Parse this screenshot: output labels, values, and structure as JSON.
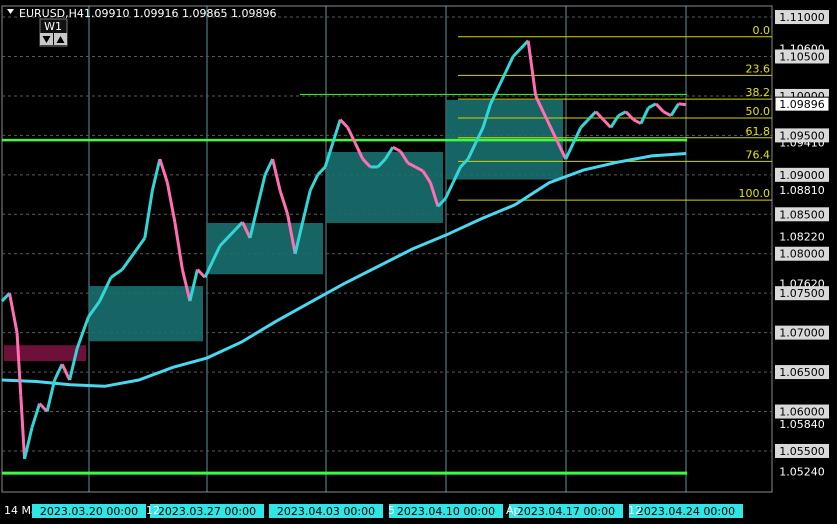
{
  "header": {
    "symbol": "EURUSD,H4",
    "ohlc": "1.09910 1.09916 1.09865 1.09896",
    "badge": "W1"
  },
  "chart_data": {
    "type": "candlestick",
    "symbol": "EURUSD",
    "timeframe": "H4",
    "ylim": [
      1.0498,
      1.1114
    ],
    "x_time_labels": [
      "14 Ma",
      "2023.03.20 00:00",
      "2023.03.27 00:00",
      "2023.04.03 00:00",
      "2023.04.10 00:00",
      "2023.04.17 00:00",
      "2023.04.24 00:00"
    ],
    "x_partial_labels": [
      "12",
      "5",
      "Ap",
      "12"
    ],
    "y_ticks": [
      1.11,
      1.106,
      1.105,
      1.1,
      1.09896,
      1.0941,
      1.095,
      1.09,
      1.0881,
      1.085,
      1.0822,
      1.08,
      1.0762,
      1.075,
      1.07,
      1.065,
      1.06,
      1.0584,
      1.055,
      1.0524
    ],
    "y_boxed_levels": [
      1.11,
      1.105,
      1.1,
      1.095,
      1.09,
      1.085,
      1.08,
      1.075,
      1.07,
      1.065,
      1.06,
      1.055
    ],
    "current_price": 1.09896,
    "fibonacci": {
      "levels": [
        {
          "label": "0.0",
          "price": 1.1075
        },
        {
          "label": "23.6",
          "price": 1.1026
        },
        {
          "label": "38.2",
          "price": 1.0996
        },
        {
          "label": "50.0",
          "price": 1.0972
        },
        {
          "label": "61.8",
          "price": 1.0947
        },
        {
          "label": "76.4",
          "price": 1.0917
        },
        {
          "label": "100.0",
          "price": 1.0868
        }
      ]
    },
    "support_resistance_lines": [
      1.0944,
      1.0522,
      1.1002
    ],
    "zones": [
      {
        "kind": "supply",
        "color": "#7a1240",
        "from": "2023.03.14",
        "to": "2023.03.17",
        "high": 1.0684,
        "low": 1.0664
      },
      {
        "kind": "demand",
        "color": "#1a6f6f",
        "from": "2023.03.21",
        "to": "2023.03.27",
        "high": 1.0759,
        "low": 1.0689
      },
      {
        "kind": "demand",
        "color": "#1a6f6f",
        "from": "2023.03.28",
        "to": "2023.04.03",
        "high": 1.0839,
        "low": 1.0774
      },
      {
        "kind": "demand",
        "color": "#1a6f6f",
        "from": "2023.04.04",
        "to": "2023.04.10",
        "high": 1.0929,
        "low": 1.0839
      },
      {
        "kind": "demand",
        "color": "#1a6f6f",
        "from": "2023.04.11",
        "to": "2023.04.17",
        "high": 1.0995,
        "low": 1.0894
      }
    ],
    "moving_average_path": [
      [
        0,
        1.064
      ],
      [
        0.05,
        1.0638
      ],
      [
        0.1,
        1.0634
      ],
      [
        0.15,
        1.0632
      ],
      [
        0.2,
        1.064
      ],
      [
        0.25,
        1.0656
      ],
      [
        0.3,
        1.0668
      ],
      [
        0.35,
        1.0688
      ],
      [
        0.4,
        1.0714
      ],
      [
        0.45,
        1.0738
      ],
      [
        0.5,
        1.0762
      ],
      [
        0.55,
        1.0784
      ],
      [
        0.6,
        1.0806
      ],
      [
        0.65,
        1.0824
      ],
      [
        0.7,
        1.0844
      ],
      [
        0.75,
        1.0862
      ],
      [
        0.8,
        1.089
      ],
      [
        0.85,
        1.0906
      ],
      [
        0.9,
        1.0916
      ],
      [
        0.95,
        1.0924
      ],
      [
        1.0,
        1.0927
      ]
    ],
    "price_path": [
      [
        0,
        1.074
      ],
      [
        0.01,
        1.075
      ],
      [
        0.02,
        1.07
      ],
      [
        0.025,
        1.062
      ],
      [
        0.03,
        1.054
      ],
      [
        0.04,
        1.058
      ],
      [
        0.05,
        1.061
      ],
      [
        0.06,
        1.06
      ],
      [
        0.07,
        1.064
      ],
      [
        0.08,
        1.066
      ],
      [
        0.09,
        1.064
      ],
      [
        0.1,
        1.068
      ],
      [
        0.115,
        1.072
      ],
      [
        0.13,
        1.074
      ],
      [
        0.145,
        1.077
      ],
      [
        0.16,
        1.078
      ],
      [
        0.175,
        1.08
      ],
      [
        0.19,
        1.082
      ],
      [
        0.2,
        1.088
      ],
      [
        0.21,
        1.092
      ],
      [
        0.22,
        1.089
      ],
      [
        0.23,
        1.084
      ],
      [
        0.24,
        1.078
      ],
      [
        0.25,
        1.074
      ],
      [
        0.26,
        1.078
      ],
      [
        0.27,
        1.077
      ],
      [
        0.28,
        1.079
      ],
      [
        0.29,
        1.081
      ],
      [
        0.3,
        1.082
      ],
      [
        0.31,
        1.083
      ],
      [
        0.32,
        1.084
      ],
      [
        0.33,
        1.082
      ],
      [
        0.34,
        1.086
      ],
      [
        0.35,
        1.09
      ],
      [
        0.36,
        1.092
      ],
      [
        0.37,
        1.088
      ],
      [
        0.38,
        1.085
      ],
      [
        0.39,
        1.08
      ],
      [
        0.4,
        1.084
      ],
      [
        0.41,
        1.088
      ],
      [
        0.42,
        1.09
      ],
      [
        0.43,
        1.091
      ],
      [
        0.44,
        1.094
      ],
      [
        0.45,
        1.097
      ],
      [
        0.46,
        1.096
      ],
      [
        0.47,
        1.094
      ],
      [
        0.48,
        1.092
      ],
      [
        0.49,
        1.091
      ],
      [
        0.5,
        1.091
      ],
      [
        0.51,
        1.092
      ],
      [
        0.52,
        1.0935
      ],
      [
        0.53,
        1.093
      ],
      [
        0.54,
        1.0915
      ],
      [
        0.55,
        1.091
      ],
      [
        0.56,
        1.0905
      ],
      [
        0.57,
        1.089
      ],
      [
        0.58,
        1.086
      ],
      [
        0.59,
        1.087
      ],
      [
        0.6,
        1.089
      ],
      [
        0.61,
        1.091
      ],
      [
        0.62,
        1.092
      ],
      [
        0.63,
        1.094
      ],
      [
        0.64,
        1.096
      ],
      [
        0.65,
        1.099
      ],
      [
        0.66,
        1.101
      ],
      [
        0.67,
        1.103
      ],
      [
        0.68,
        1.105
      ],
      [
        0.69,
        1.106
      ],
      [
        0.7,
        1.107
      ],
      [
        0.71,
        1.1
      ],
      [
        0.72,
        1.098
      ],
      [
        0.73,
        1.096
      ],
      [
        0.74,
        1.094
      ],
      [
        0.75,
        1.092
      ],
      [
        0.76,
        1.094
      ],
      [
        0.77,
        1.096
      ],
      [
        0.78,
        1.097
      ],
      [
        0.79,
        1.098
      ],
      [
        0.8,
        1.097
      ],
      [
        0.81,
        1.096
      ],
      [
        0.82,
        1.0975
      ],
      [
        0.83,
        1.098
      ],
      [
        0.84,
        1.097
      ],
      [
        0.85,
        1.0965
      ],
      [
        0.86,
        1.0985
      ],
      [
        0.87,
        1.099
      ],
      [
        0.88,
        1.098
      ],
      [
        0.89,
        1.0975
      ],
      [
        0.9,
        1.099
      ],
      [
        0.91,
        1.0989
      ]
    ]
  }
}
